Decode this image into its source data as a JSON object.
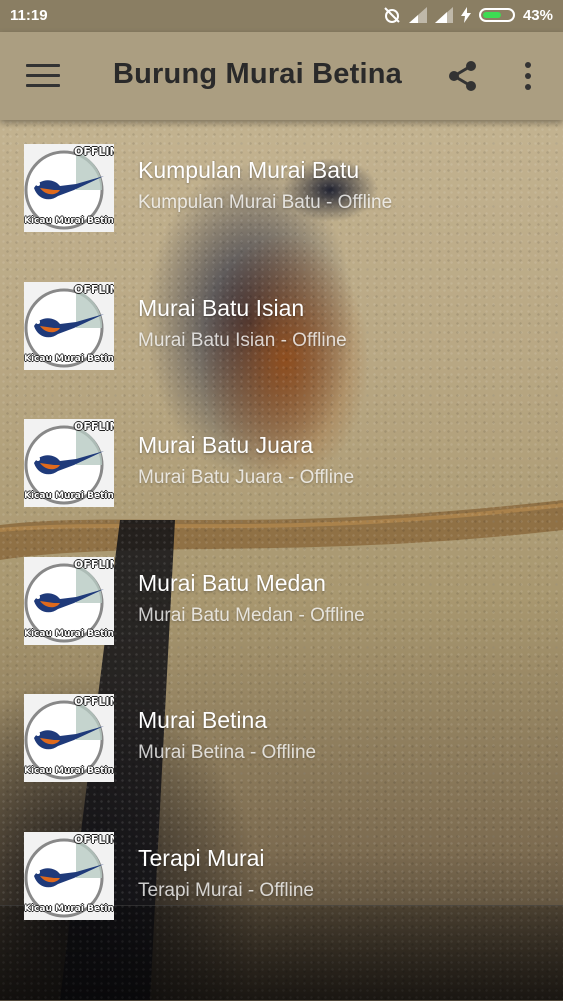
{
  "status_bar": {
    "time": "11:19",
    "battery_percent": "43%",
    "icons": [
      "alarm-off-icon",
      "signal-icon",
      "signal-icon",
      "charging-icon",
      "battery-icon"
    ],
    "battery_color": "#3ddc53"
  },
  "app_bar": {
    "title": "Burung Murai Betina",
    "icons": [
      "menu-icon",
      "share-icon",
      "more-vert-icon"
    ],
    "background": "#ab9e81"
  },
  "thumbnail": {
    "badge": "OFFLINE",
    "caption": "Kicau Murai Betina"
  },
  "list": {
    "items": [
      {
        "title": "Kumpulan Murai Batu",
        "subtitle": "Kumpulan Murai Batu - Offline"
      },
      {
        "title": "Murai Batu Isian",
        "subtitle": "Murai Batu Isian - Offline"
      },
      {
        "title": "Murai Batu Juara",
        "subtitle": "Murai Batu Juara - Offline"
      },
      {
        "title": "Murai Batu Medan",
        "subtitle": "Murai Batu Medan - Offline"
      },
      {
        "title": "Murai Betina",
        "subtitle": "Murai Betina - Offline"
      },
      {
        "title": "Terapi Murai",
        "subtitle": "Terapi Murai - Offline"
      }
    ]
  }
}
